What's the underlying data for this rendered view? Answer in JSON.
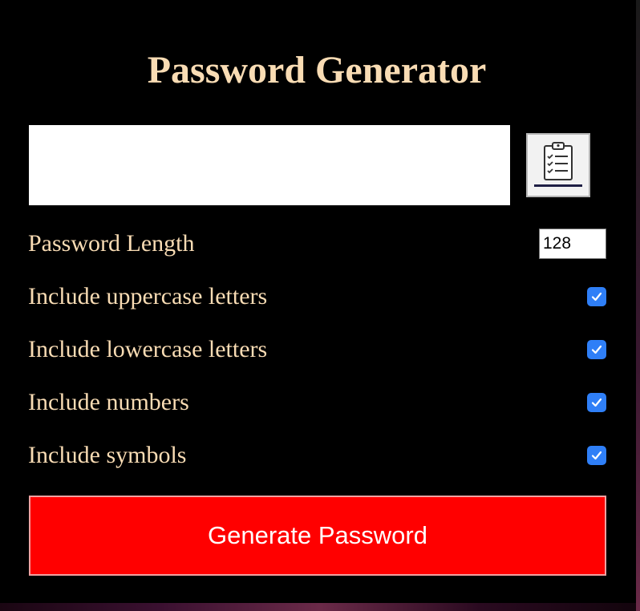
{
  "app": {
    "title": "Password Generator"
  },
  "result": {
    "value": ""
  },
  "copy_button": {
    "icon": "clipboard-checklist-icon"
  },
  "settings": {
    "length": {
      "label": "Password Length",
      "value": "128"
    },
    "uppercase": {
      "label": "Include uppercase letters",
      "checked": true
    },
    "lowercase": {
      "label": "Include lowercase letters",
      "checked": true
    },
    "numbers": {
      "label": "Include numbers",
      "checked": true
    },
    "symbols": {
      "label": "Include symbols",
      "checked": true
    }
  },
  "generate_button": {
    "label": "Generate Password"
  },
  "colors": {
    "background": "#000000",
    "text_accent": "#f9dcb4",
    "button": "#ff0000",
    "checkbox": "#2f7ff7"
  }
}
